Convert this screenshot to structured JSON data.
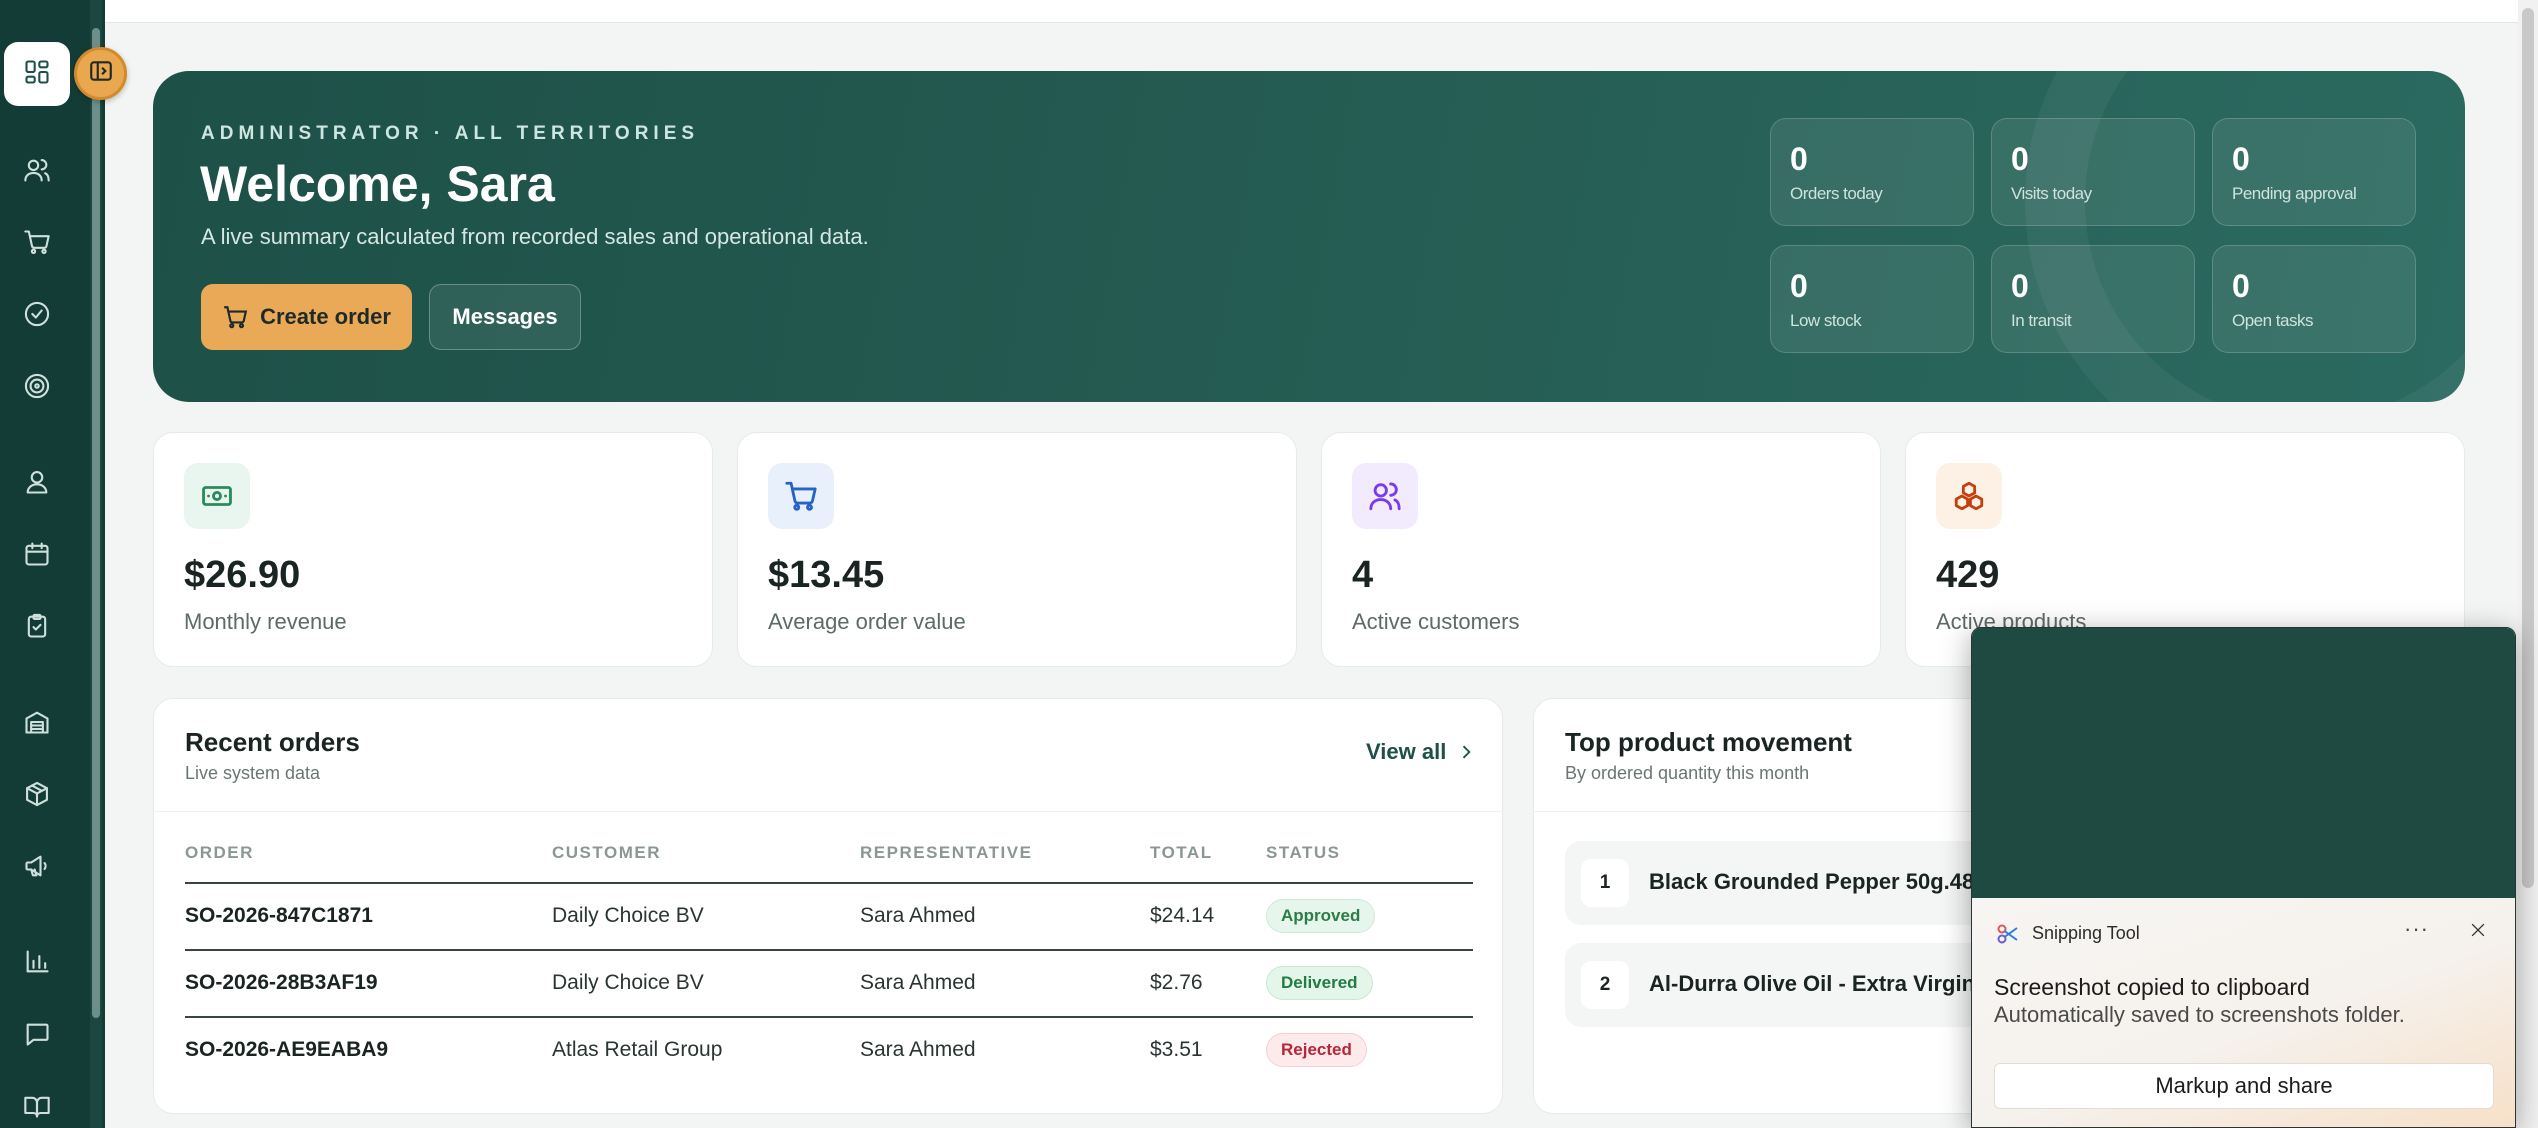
{
  "sidebar": {
    "icons": [
      "dashboard-icon",
      "sidebar-toggle-icon",
      "users-icon",
      "cart-icon",
      "check-circle-icon",
      "target-icon",
      "contact-icon",
      "calendar-icon",
      "clipboard-icon",
      "building-icon",
      "package-icon",
      "megaphone-icon",
      "bar-chart-icon",
      "message-icon",
      "book-icon"
    ]
  },
  "hero": {
    "eyebrow": "ADMINISTRATOR · ALL TERRITORIES",
    "title": "Welcome, Sara",
    "subtitle": "A live summary calculated from recorded sales and operational data.",
    "create_order_label": "Create order",
    "messages_label": "Messages",
    "stats": [
      {
        "value": "0",
        "label": "Orders today"
      },
      {
        "value": "0",
        "label": "Visits today"
      },
      {
        "value": "0",
        "label": "Pending approval"
      },
      {
        "value": "0",
        "label": "Low stock"
      },
      {
        "value": "0",
        "label": "In transit"
      },
      {
        "value": "0",
        "label": "Open tasks"
      }
    ]
  },
  "kpis": [
    {
      "value": "$26.90",
      "label": "Monthly revenue",
      "icon": "cash-icon",
      "color": "#2a8a5a",
      "bg": "#e8f6ef"
    },
    {
      "value": "$13.45",
      "label": "Average order value",
      "icon": "cart-icon",
      "color": "#2563c9",
      "bg": "#e8f0fc"
    },
    {
      "value": "4",
      "label": "Active customers",
      "icon": "users-icon",
      "color": "#7c3aed",
      "bg": "#f1ebfd"
    },
    {
      "value": "429",
      "label": "Active products",
      "icon": "boxes-icon",
      "color": "#c2410c",
      "bg": "#fdf1e6"
    }
  ],
  "recent_orders": {
    "title": "Recent orders",
    "subtitle": "Live system data",
    "view_all": "View all",
    "columns": [
      "ORDER",
      "CUSTOMER",
      "REPRESENTATIVE",
      "TOTAL",
      "STATUS"
    ],
    "rows": [
      {
        "order": "SO-2026-847C1871",
        "customer": "Daily Choice BV",
        "rep": "Sara Ahmed",
        "total": "$24.14",
        "status": "Approved"
      },
      {
        "order": "SO-2026-28B3AF19",
        "customer": "Daily Choice BV",
        "rep": "Sara Ahmed",
        "total": "$2.76",
        "status": "Delivered"
      },
      {
        "order": "SO-2026-AE9EABA9",
        "customer": "Atlas Retail Group",
        "rep": "Sara Ahmed",
        "total": "$3.51",
        "status": "Rejected"
      }
    ]
  },
  "movement": {
    "title": "Top product movement",
    "subtitle": "By ordered quantity this month",
    "items": [
      {
        "rank": "1",
        "name": "Black Grounded Pepper 50g.48"
      },
      {
        "rank": "2",
        "name": "Al-Durra Olive Oil - Extra Virgin -"
      }
    ]
  },
  "toast": {
    "app": "Snipping Tool",
    "more": "···",
    "message": "Screenshot copied to clipboard",
    "detail": "Automatically saved to screenshots folder.",
    "button": "Markup and share"
  }
}
